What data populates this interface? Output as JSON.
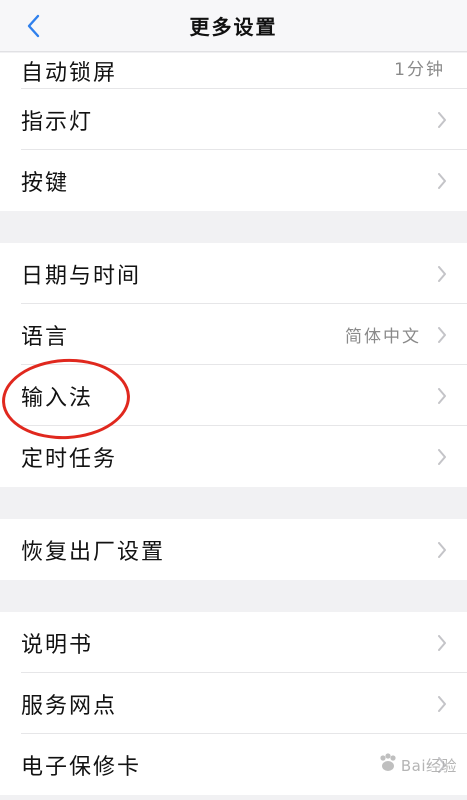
{
  "header": {
    "title": "更多设置",
    "back_icon": "chevron-left-icon"
  },
  "groups": [
    {
      "items": [
        {
          "label": "自动锁屏",
          "value": "1分钟"
        },
        {
          "label": "指示灯"
        },
        {
          "label": "按键"
        }
      ]
    },
    {
      "items": [
        {
          "label": "日期与时间"
        },
        {
          "label": "语言",
          "value": "简体中文"
        },
        {
          "label": "输入法"
        },
        {
          "label": "定时任务"
        }
      ]
    },
    {
      "items": [
        {
          "label": "恢复出厂设置"
        }
      ]
    },
    {
      "items": [
        {
          "label": "说明书"
        },
        {
          "label": "服务网点"
        },
        {
          "label": "电子保修卡"
        }
      ]
    }
  ],
  "annotation": {
    "highlight_color": "#e0281e"
  },
  "watermark": {
    "text": "Bai经验"
  },
  "colors": {
    "accent": "#2f80ed",
    "chevron": "#c4c4c8",
    "background": "#f1f1f3"
  }
}
